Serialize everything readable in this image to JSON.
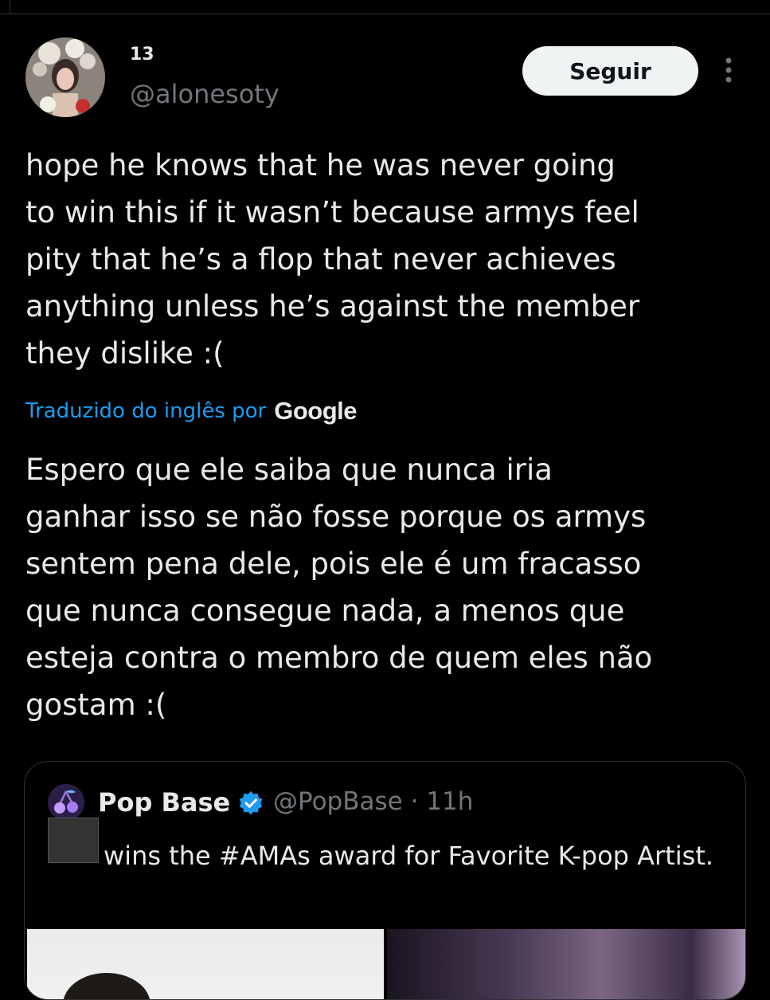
{
  "tweet": {
    "author": {
      "display_name": "13",
      "handle": "@alonesoty",
      "avatar": "profile-photo"
    },
    "follow_label": "Seguir",
    "more_icon": "more-vertical-icon",
    "text": "hope he knows that he was never going\nto win this if it wasn’t because armys feel\npity that he’s a flop that never achieves\nanything unless he’s against the member\nthey dislike :(",
    "translation": {
      "label": "Traduzido do inglês por",
      "provider": "Google",
      "text": "Espero que ele saiba que nunca iria\nganhar isso se não fosse porque os armys\nsentem pena dele, pois ele é um fracasso\nque nunca consegue nada, a menos que\nesteja contra o membro de quem eles não\ngostam :("
    }
  },
  "quoted_tweet": {
    "author": {
      "display_name": "Pop Base",
      "verified_icon": "verified-badge-icon",
      "handle": "@PopBase",
      "time": "11h",
      "avatar": "cherry-logo"
    },
    "meta": "@PopBase · 11h",
    "text": "wins the #AMAs award for Favorite K-pop Artist."
  },
  "colors": {
    "background": "#000000",
    "text": "#e7e9ea",
    "secondary": "#71767b",
    "link": "#1d9bf0",
    "verified": "#1d9bf0",
    "border": "#2f3336",
    "button_bg": "#eff3f4"
  }
}
